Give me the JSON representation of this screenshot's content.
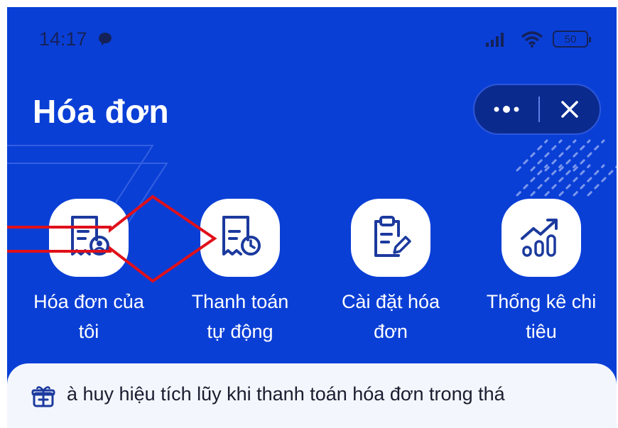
{
  "status_bar": {
    "time": "14:17",
    "battery": "50"
  },
  "header": {
    "title": "Hóa đơn"
  },
  "menu": {
    "items": [
      {
        "label_line1": "Hóa đơn của",
        "label_line2": "tôi",
        "icon": "receipt-user-icon"
      },
      {
        "label_line1": "Thanh toán",
        "label_line2": "tự động",
        "icon": "receipt-clock-icon"
      },
      {
        "label_line1": "Cài đặt hóa",
        "label_line2": "đơn",
        "icon": "clipboard-edit-icon"
      },
      {
        "label_line1": "Thống kê chi",
        "label_line2": "tiêu",
        "icon": "bar-chart-trend-icon"
      }
    ]
  },
  "promo": {
    "text": "à huy hiệu tích lũy khi thanh toán hóa đơn trong thá",
    "icon": "gift-icon"
  },
  "colors": {
    "background_blue": "#0a3fd6",
    "icon_blue": "#1c3a9e",
    "annotation_red": "#e0101a"
  }
}
